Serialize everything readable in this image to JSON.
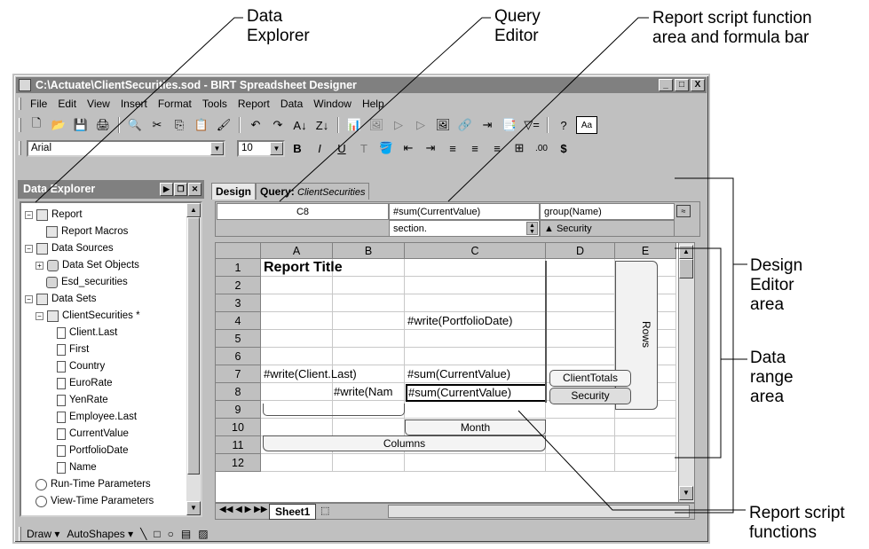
{
  "callouts": {
    "data_explorer": "Data\nExplorer",
    "query_editor": "Query\nEditor",
    "report_script_area": "Report script function\narea and formula bar",
    "design_editor": "Design\nEditor\narea",
    "data_range": "Data\nrange\narea",
    "report_script_functions": "Report script\nfunctions"
  },
  "window": {
    "title": "C:\\Actuate\\ClientSecurities.sod - BIRT Spreadsheet Designer",
    "controls": [
      "_",
      "□",
      "X"
    ]
  },
  "menu": [
    "File",
    "Edit",
    "View",
    "Insert",
    "Format",
    "Tools",
    "Report",
    "Data",
    "Window",
    "Help"
  ],
  "toolbar1": {
    "icons": [
      "new-icon",
      "open-icon",
      "save-icon",
      "print-icon",
      "find-icon",
      "cut-icon",
      "copy-icon",
      "paste-icon",
      "format-painter-icon",
      "undo-icon",
      "redo-icon",
      "sort-asc-icon",
      "sort-desc-icon",
      "chart-icon",
      "picture-icon",
      "run-icon",
      "step-icon",
      "image-icon",
      "hyperlink-icon",
      "export-icon",
      "report-icon",
      "filter-icon",
      "help-icon",
      "font-size-icon"
    ],
    "glyphs": [
      "🗋",
      "📂",
      "💾",
      "🖨",
      "🔍",
      "✂",
      "⎘",
      "📋",
      "🖌",
      "↶",
      "↷",
      "A↓",
      "Z↓",
      "📊",
      "🖼",
      "▷",
      "▷",
      "🖼",
      "🔗",
      "⇥",
      "📑",
      "▽=",
      "?",
      "Aa"
    ]
  },
  "toolbar2": {
    "font": "Arial",
    "size": "10",
    "icons": [
      "bold-icon",
      "italic-icon",
      "underline-icon",
      "font-color-icon",
      "fill-icon",
      "indent-icon",
      "outdent-icon",
      "align-left-icon",
      "align-center-icon",
      "align-right-icon",
      "merge-icon",
      "decimal-icon",
      "currency-icon"
    ],
    "glyphs": [
      "B",
      "I",
      "U",
      "T",
      "🪣",
      "⇤",
      "⇥",
      "≡",
      "≡",
      "≡",
      "⊞",
      ".00",
      "$"
    ]
  },
  "explorer": {
    "title": "Data Explorer",
    "tree": [
      {
        "label": "Report",
        "indent": 0,
        "expander": "-",
        "icon": "report-icon"
      },
      {
        "label": "Report Macros",
        "indent": 2,
        "expander": "",
        "icon": "macro-icon"
      },
      {
        "label": "Data Sources",
        "indent": 0,
        "expander": "-",
        "icon": "data-sources-icon"
      },
      {
        "label": "Data Set Objects",
        "indent": 1,
        "expander": "+",
        "icon": "database-icon"
      },
      {
        "label": "Esd_securities",
        "indent": 2,
        "expander": "",
        "icon": "database-icon"
      },
      {
        "label": "Data Sets",
        "indent": 0,
        "expander": "-",
        "icon": "data-sets-icon"
      },
      {
        "label": "ClientSecurities *",
        "indent": 1,
        "expander": "-",
        "icon": "query-icon"
      },
      {
        "label": "Client.Last",
        "indent": 3,
        "expander": "",
        "icon": "field-icon"
      },
      {
        "label": "First",
        "indent": 3,
        "expander": "",
        "icon": "field-icon"
      },
      {
        "label": "Country",
        "indent": 3,
        "expander": "",
        "icon": "field-icon"
      },
      {
        "label": "EuroRate",
        "indent": 3,
        "expander": "",
        "icon": "field-icon"
      },
      {
        "label": "YenRate",
        "indent": 3,
        "expander": "",
        "icon": "field-icon"
      },
      {
        "label": "Employee.Last",
        "indent": 3,
        "expander": "",
        "icon": "field-icon"
      },
      {
        "label": "CurrentValue",
        "indent": 3,
        "expander": "",
        "icon": "field-icon"
      },
      {
        "label": "PortfolioDate",
        "indent": 3,
        "expander": "",
        "icon": "field-icon"
      },
      {
        "label": "Name",
        "indent": 3,
        "expander": "",
        "icon": "field-icon"
      },
      {
        "label": "Run-Time Parameters",
        "indent": 1,
        "expander": "",
        "icon": "parameter-icon"
      },
      {
        "label": "View-Time Parameters",
        "indent": 1,
        "expander": "",
        "icon": "parameter-icon"
      }
    ]
  },
  "tabs": {
    "design": "Design",
    "query_prefix": "Query:",
    "query_name": "ClientSecurities"
  },
  "formula": {
    "cell_ref": "C8",
    "function": "#sum(CurrentValue)",
    "group": "group(Name)",
    "section": "section.",
    "security": "▲ Security"
  },
  "grid": {
    "columns": [
      "A",
      "B",
      "C",
      "D",
      "E"
    ],
    "rows": [
      "1",
      "2",
      "3",
      "4",
      "5",
      "6",
      "7",
      "8",
      "9",
      "10",
      "11",
      "12"
    ],
    "cells": {
      "title": "Report Title",
      "r4c": "#write(PortfolioDate)",
      "r7a": "#write(Client.Last)",
      "r7c": "#sum(CurrentValue)",
      "r8b": "#write(Nam",
      "r8c": "#sum(CurrentValue)"
    },
    "bands": {
      "rows": "Rows",
      "client_totals": "ClientTotals",
      "security": "Security",
      "month": "Month",
      "columns": "Columns"
    },
    "sheet_tab": "Sheet1"
  },
  "drawbar": {
    "draw": "Draw",
    "autoshapes": "AutoShapes"
  }
}
